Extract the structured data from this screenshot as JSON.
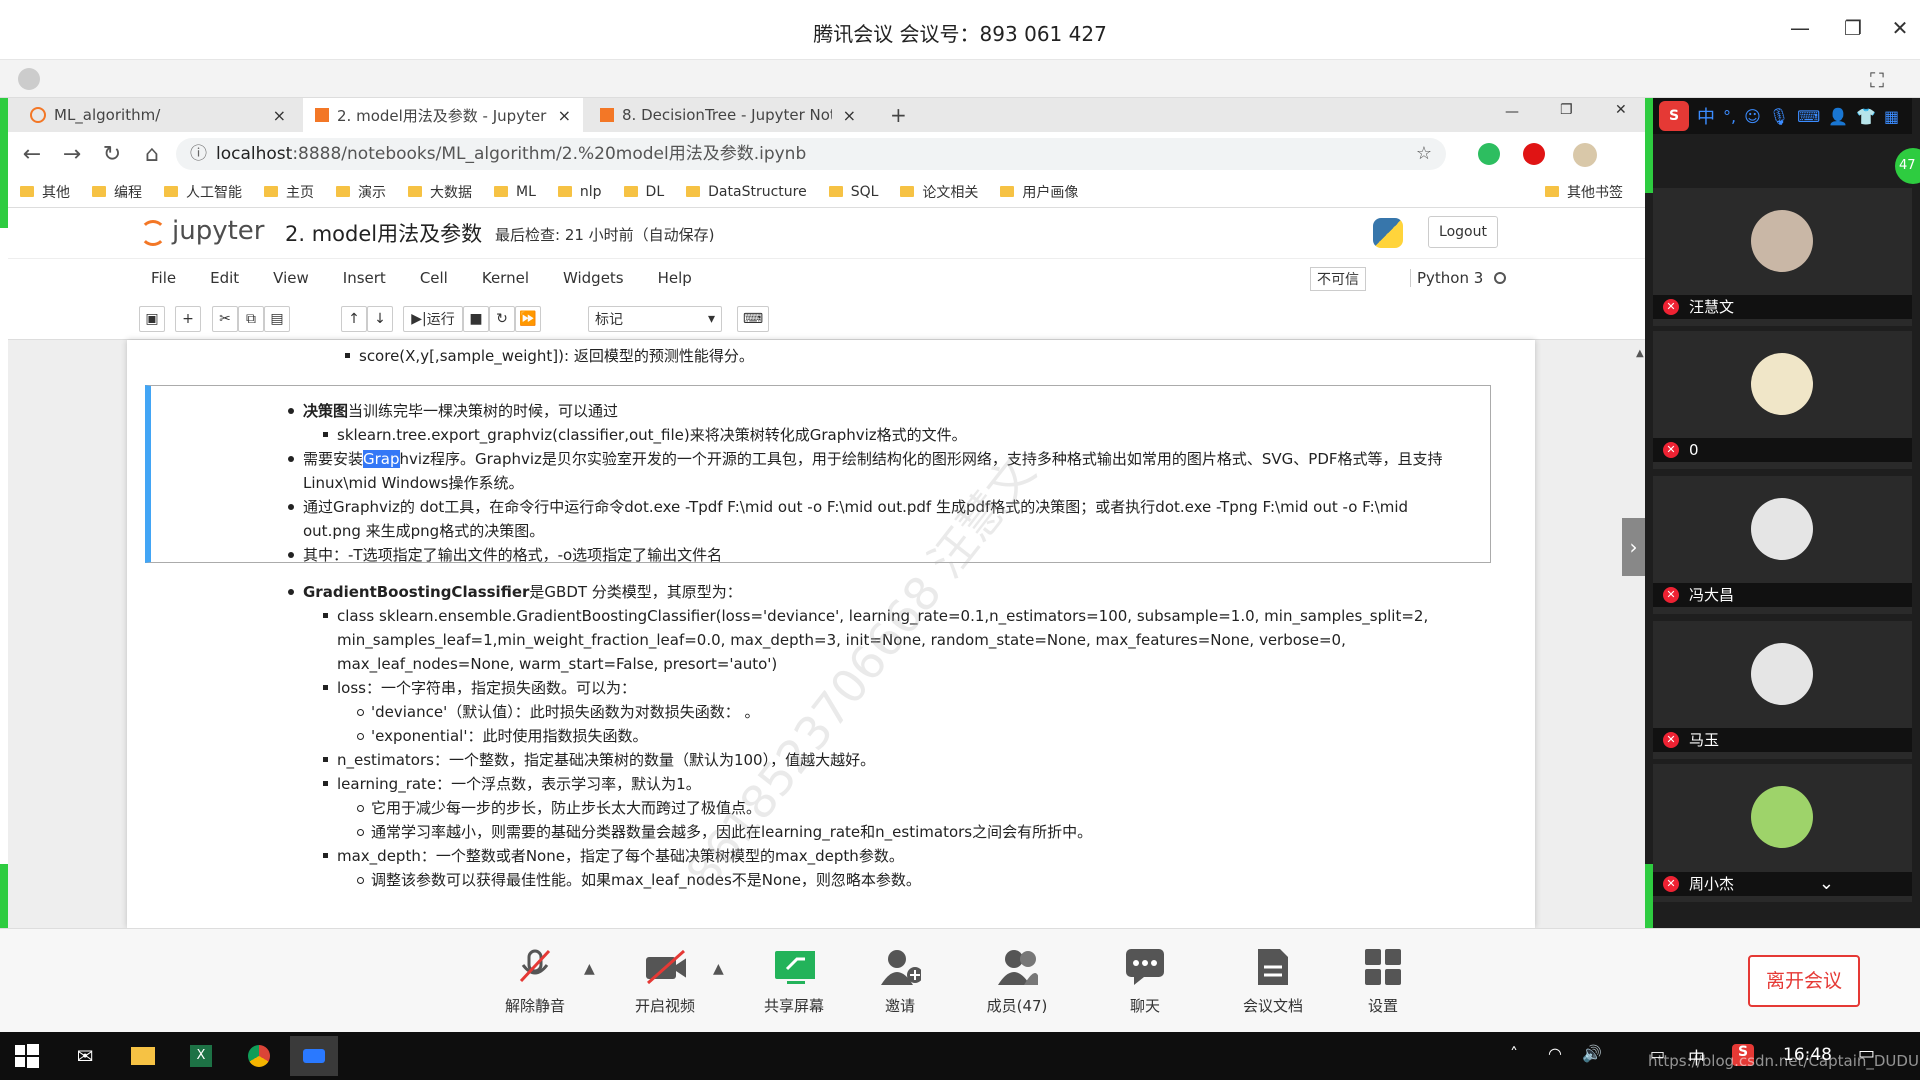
{
  "meeting": {
    "title": "腾讯会议 会议号：893 061 427"
  },
  "browser": {
    "tabs": [
      {
        "label": "ML_algorithm/",
        "close": "×"
      },
      {
        "label": "2. model用法及参数 - Jupyter N",
        "close": "×"
      },
      {
        "label": "8. DecisionTree - Jupyter Not",
        "close": "×"
      }
    ],
    "new_tab": "+",
    "url_host": "localhost",
    "url_path": ":8888/notebooks/ML_algorithm/2.%20model用法及参数.ipynb",
    "bookmarks": [
      "其他",
      "编程",
      "人工智能",
      "主页",
      "演示",
      "大数据",
      "ML",
      "nlp",
      "DL",
      "DataStructure",
      "SQL",
      "论文相关",
      "用户画像"
    ],
    "other_bookmarks": "其他书签"
  },
  "jupyter": {
    "logo": "jupyter",
    "notebook_title": "2. model用法及参数",
    "checkpoint": "最后检查: 21 小时前（自动保存)",
    "logout": "Logout",
    "menu": [
      "File",
      "Edit",
      "View",
      "Insert",
      "Cell",
      "Kernel",
      "Widgets",
      "Help"
    ],
    "trust": "不可信",
    "kernel": "Python 3",
    "run_label": "运行",
    "cell_type": "标记"
  },
  "notebook": {
    "top_item": "score(X,y[,sample_weight]): 返回模型的预测性能得分。",
    "cell1": {
      "i1_bold": "决策图",
      "i1_rest": "当训练完毕一棵决策树的时候，可以通过",
      "i1_sub": "sklearn.tree.export_graphviz(classifier,out_file)来将决策树转化成Graphviz格式的文件。",
      "i2_pre": "需要安装",
      "i2_hl": "Grap",
      "i2_rest": "hviz程序。Graphviz是贝尔实验室开发的一个开源的工具包，用于绘制结构化的图形网络，支持多种格式输出如常用的图片格式、SVG、PDF格式等，且支持Linux\\mid Windows操作系统。",
      "i3": "通过Graphviz的 dot工具，在命令行中运行命令dot.exe -Tpdf F:\\mid out -o F:\\mid out.pdf 生成pdf格式的决策图；或者执行dot.exe -Tpng F:\\mid out -o F:\\mid out.png 来生成png格式的决策图。",
      "i4": "其中：-T选项指定了输出文件的格式，-o选项指定了输出文件名"
    },
    "cell2": {
      "title_bold": "GradientBoostingClassifier",
      "title_rest": "是GBDT 分类模型，其原型为：",
      "proto": "class sklearn.ensemble.GradientBoostingClassifier(loss='deviance', learning_rate=0.1,n_estimators=100, subsample=1.0, min_samples_split=2, min_samples_leaf=1,min_weight_fraction_leaf=0.0, max_depth=3, init=None, random_state=None, max_features=None, verbose=0, max_leaf_nodes=None, warm_start=False, presort='auto')",
      "loss": "loss：一个字符串，指定损失函数。可以为：",
      "loss_a": "'deviance'（默认值）：此时损失函数为对数损失函数：  。",
      "loss_b": "'exponential'：此时使用指数损失函数。",
      "n_est": "n_estimators：一个整数，指定基础决策树的数量（默认为100），值越大越好。",
      "lr": "learning_rate：一个浮点数，表示学习率，默认为1。",
      "lr_a": "它用于减少每一步的步长，防止步长太大而跨过了极值点。",
      "lr_b": "通常学习率越小，则需要的基础分类器数量会越多，因此在learning_rate和n_estimators之间会有所折中。",
      "md": "max_depth：一个整数或者None，指定了每个基础决策树模型的max_depth参数。",
      "md_a": "调整该参数可以获得最佳性能。如果max_leaf_nodes不是None，则忽略本参数。"
    },
    "watermark": "8618523706668 汪慧文"
  },
  "participants": [
    {
      "name": "汪慧文"
    },
    {
      "name": "0"
    },
    {
      "name": "冯大昌"
    },
    {
      "name": "马玉"
    },
    {
      "name": "周小杰"
    }
  ],
  "participant_count": "47",
  "ime_label": "中",
  "meeting_bar": {
    "buttons": [
      "解除静音",
      "开启视频",
      "共享屏幕",
      "邀请",
      "成员(47)",
      "聊天",
      "会议文档",
      "设置"
    ],
    "leave": "离开会议"
  },
  "taskbar": {
    "time": "16:48",
    "ime": "中",
    "watermark": "https://blog.csdn.net/Captain_DUDU"
  },
  "colors": {
    "accent": "#2ecc40",
    "selected_cell": "#42a5f5",
    "leave": "#e53935",
    "highlight": "#3478f6"
  }
}
